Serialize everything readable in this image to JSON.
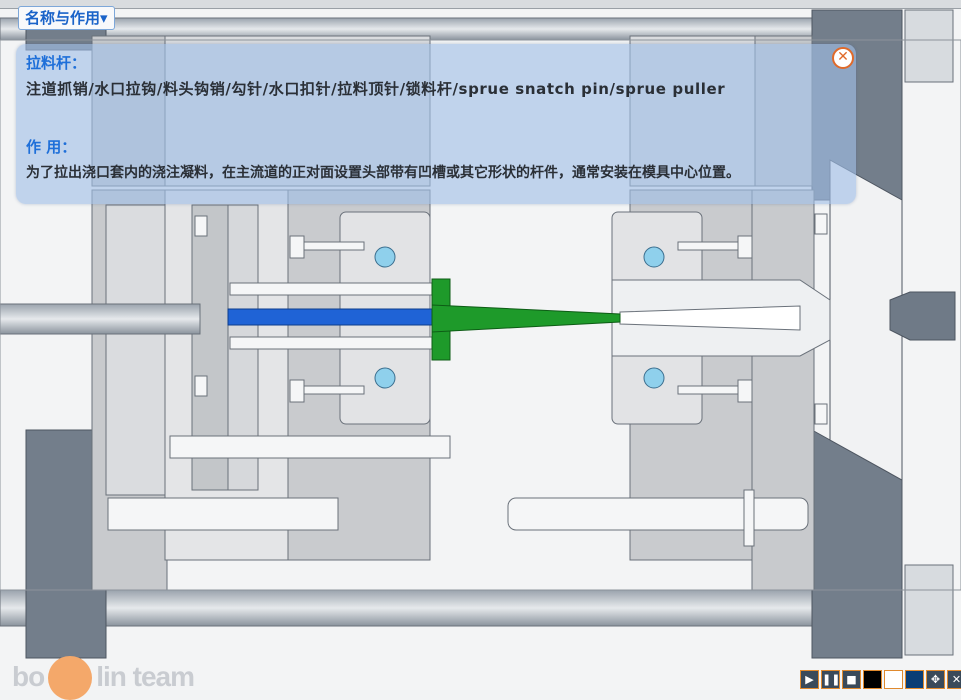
{
  "menu": {
    "label": "名称与作用▾"
  },
  "info": {
    "title": "拉料杆：",
    "names": "注道抓销/水口拉钩/料头钩销/勾针/水口扣针/拉料顶针/锁料杆/sprue snatch pin/sprue puller",
    "function_title": "作 用：",
    "function_text": "为了拉出浇口套内的浇注凝料，在主流道的正对面设置头部带有凹槽或其它形状的杆件，通常安装在模具中心位置。",
    "close_glyph": "✕"
  },
  "logo": {
    "left": "bo",
    "right": "lin team"
  },
  "player": {
    "buttons": [
      {
        "name": "play-button",
        "glyph": "▶"
      },
      {
        "name": "pause-button",
        "glyph": "❚❚"
      },
      {
        "name": "stop-button",
        "glyph": "■"
      },
      {
        "name": "color-black-button",
        "glyph": ""
      },
      {
        "name": "color-white-button",
        "glyph": ""
      },
      {
        "name": "color-blue-button",
        "glyph": ""
      },
      {
        "name": "move-button",
        "glyph": "✥"
      },
      {
        "name": "close-player-button",
        "glyph": "✕"
      }
    ]
  },
  "colors": {
    "highlight_blue": "#1f63d6",
    "highlight_green": "#1e9a2a",
    "cooling_hole": "#8fd0ec",
    "plate_gray": "#c9cbce",
    "platen_dark": "#6f7a87",
    "panel_title": "#1e6fd9"
  }
}
